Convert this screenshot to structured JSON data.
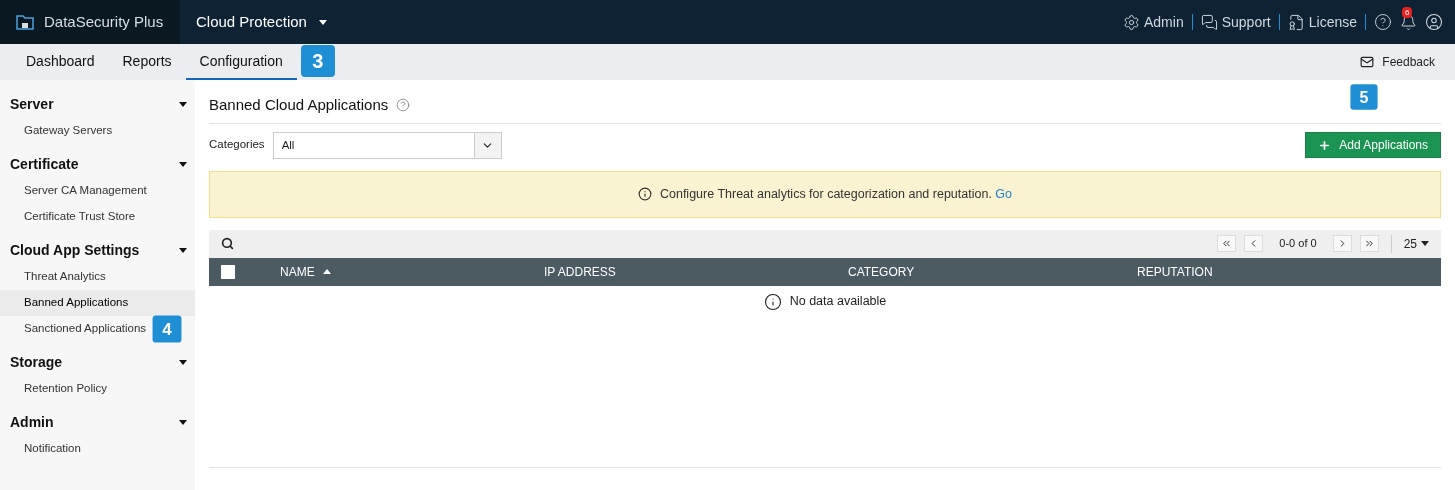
{
  "header": {
    "product": "DataSecurity Plus",
    "module": "Cloud Protection",
    "links": [
      {
        "kind": "admin",
        "label": "Admin"
      },
      {
        "kind": "support",
        "label": "Support"
      },
      {
        "kind": "license",
        "label": "License"
      }
    ],
    "notification_count": "6"
  },
  "tabs": [
    {
      "label": "Dashboard",
      "selected": false
    },
    {
      "label": "Reports",
      "selected": false
    },
    {
      "label": "Configuration",
      "selected": true
    }
  ],
  "feedback": "Feedback",
  "sidebar": [
    {
      "label": "Server",
      "expanded": true,
      "children": [
        {
          "label": "Gateway Servers",
          "selected": false
        }
      ]
    },
    {
      "label": "Certificate",
      "expanded": true,
      "children": [
        {
          "label": "Server CA Management",
          "selected": false
        },
        {
          "label": "Certificate Trust Store",
          "selected": false
        }
      ]
    },
    {
      "label": "Cloud App Settings",
      "expanded": true,
      "children": [
        {
          "label": "Threat Analytics",
          "selected": false
        },
        {
          "label": "Banned Applications",
          "selected": true
        },
        {
          "label": "Sanctioned Applications",
          "selected": false
        }
      ]
    },
    {
      "label": "Storage",
      "expanded": true,
      "children": [
        {
          "label": "Retention Policy",
          "selected": false
        }
      ]
    },
    {
      "label": "Admin",
      "expanded": true,
      "children": [
        {
          "label": "Notification",
          "selected": false
        }
      ]
    }
  ],
  "page_title": "Banned Cloud Applications",
  "filter": {
    "label": "Categories",
    "value": "All"
  },
  "add_button": "Add Applications",
  "notice": {
    "text": "Configure Threat analytics for categorization and reputation.",
    "link": "Go"
  },
  "pagination": {
    "range": "0-0 of 0",
    "page_size": "25"
  },
  "table": {
    "columns": [
      {
        "label": "NAME",
        "sorted": true
      },
      {
        "label": "IP ADDRESS",
        "sorted": false
      },
      {
        "label": "CATEGORY",
        "sorted": false
      },
      {
        "label": "REPUTATION",
        "sorted": false
      }
    ],
    "select_all": false,
    "empty": "No data available"
  },
  "callouts": [
    {
      "number": "3"
    },
    {
      "number": "4"
    },
    {
      "number": "5"
    }
  ]
}
